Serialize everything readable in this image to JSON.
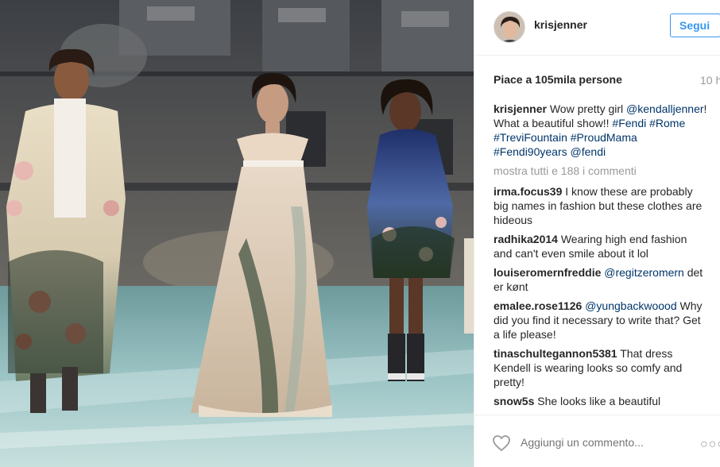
{
  "post": {
    "image_alt": "Fendi runway models at the Trevi Fountain"
  },
  "header": {
    "username": "krisjenner",
    "follow_label": "Segui"
  },
  "stats": {
    "likes": "Piace a 105mila persone",
    "time": "10 h"
  },
  "caption": {
    "user": "krisjenner",
    "parts": [
      {
        "type": "text",
        "value": " Wow pretty girl "
      },
      {
        "type": "mention",
        "value": "@kendalljenner"
      },
      {
        "type": "text",
        "value": "! What a beautiful show!! "
      },
      {
        "type": "tag",
        "value": "#Fendi"
      },
      {
        "type": "text",
        "value": " "
      },
      {
        "type": "tag",
        "value": "#Rome"
      },
      {
        "type": "text",
        "value": " "
      },
      {
        "type": "tag",
        "value": "#TreviFountain"
      },
      {
        "type": "text",
        "value": " "
      },
      {
        "type": "tag",
        "value": "#ProudMama"
      },
      {
        "type": "text",
        "value": " "
      },
      {
        "type": "tag",
        "value": "#Fendi90years"
      },
      {
        "type": "text",
        "value": " "
      },
      {
        "type": "mention",
        "value": "@fendi"
      }
    ]
  },
  "show_all": "mostra tutti e 188 i commenti",
  "comments": [
    {
      "user": "irma.focus39",
      "mention": "",
      "text": " I know these are probably big names in fashion but these clothes are hideous"
    },
    {
      "user": "radhika2014",
      "mention": "",
      "text": " Wearing high end fashion and can't even smile about it lol"
    },
    {
      "user": "louiseromernfreddie",
      "mention": "@regitzeromern",
      "text": " det er kønt"
    },
    {
      "user": "emalee.rose1126",
      "mention": "@yungbackwoood",
      "text": " Why did you find it necessary to write that? Get a life please!"
    },
    {
      "user": "tinaschultegannon5381",
      "mention": "",
      "text": " That dress Kendell is wearing looks so comfy and pretty!"
    },
    {
      "user": "snow5s",
      "mention": "",
      "text": " She looks like a beautiful"
    }
  ],
  "add_comment": {
    "placeholder": "Aggiungi un commento...",
    "heart_icon": "heart-outline-icon",
    "more_icon": "more-options-icon"
  },
  "colors": {
    "link": "#003569",
    "follow": "#3897f0",
    "muted": "#999999"
  }
}
